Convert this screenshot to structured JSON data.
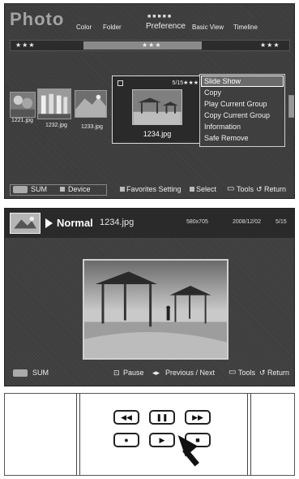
{
  "browser": {
    "app_title": "Photo",
    "tabs": [
      "Color",
      "Folder",
      "Preference",
      "Basic View",
      "Timeline"
    ],
    "active_tab": "Preference",
    "rating_groups": [
      "★★★",
      "★★★",
      "★★★"
    ],
    "thumbnails": [
      {
        "label": "1221.jpg"
      },
      {
        "label": "1232.jpg"
      },
      {
        "label": "1233.jpg"
      }
    ],
    "selected": {
      "index": "5/15",
      "rating": "★★★",
      "label": "1234.jpg"
    },
    "tools_menu": [
      "Slide Show",
      "Copy",
      "Play Current Group",
      "Copy Current Group",
      "Information",
      "Safe Remove"
    ],
    "selected_menu_item": "Slide Show",
    "footer": {
      "sum_label": "SUM",
      "device_label": "Device",
      "favorites": "Favorites Setting",
      "select": "Select",
      "tools": "Tools",
      "return": "Return"
    }
  },
  "viewer": {
    "mode": "Normal",
    "filename": "1234.jpg",
    "resolution": "580x705",
    "date": "2008/12/02",
    "page": "5/15",
    "footer": {
      "sum_label": "SUM",
      "pause": "Pause",
      "prev_next": "Previous / Next",
      "tools": "Tools",
      "return": "Return"
    }
  },
  "remote": {
    "buttons": [
      "rewind-icon",
      "pause-icon",
      "fast-forward-icon",
      "record-icon",
      "play-icon",
      "stop-icon"
    ],
    "rewind": "◀◀",
    "pause": "❚❚",
    "fastforward": "▶▶",
    "record": "●",
    "play": "▶",
    "stop": "■"
  },
  "colors": {
    "panel": "#3b3b3b",
    "highlight": "#6b6b6b",
    "text": "#f2f2f2"
  }
}
